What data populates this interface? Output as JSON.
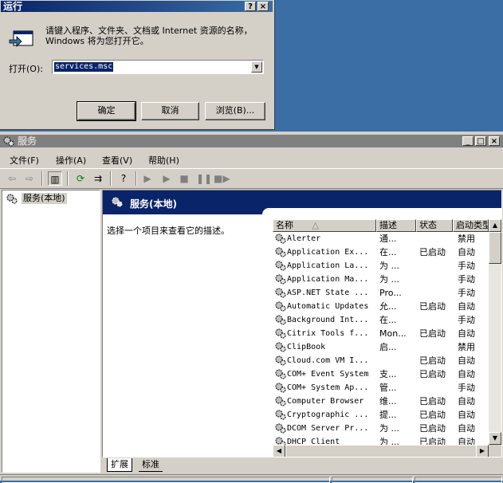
{
  "run_dialog": {
    "title": "运行",
    "help_btn": "?",
    "close_btn": "×",
    "description": "请键入程序、文件夹、文档或 Internet 资源的名称，Windows 将为您打开它。",
    "open_label": "打开(O):",
    "open_value": "services.msc",
    "buttons": {
      "ok": "确定",
      "cancel": "取消",
      "browse": "浏览(B)..."
    }
  },
  "services_window": {
    "title": "服务",
    "menus": [
      "文件(F)",
      "操作(A)",
      "查看(V)",
      "帮助(H)"
    ],
    "tree_item": "服务(本地)",
    "content_title": "服务(本地)",
    "content_desc": "选择一个项目来查看它的描述。",
    "columns": [
      "名称",
      "描述",
      "状态",
      "启动类型"
    ],
    "rows": [
      [
        "Alerter",
        "通...",
        "",
        "禁用"
      ],
      [
        "Application Ex...",
        "在...",
        "已启动",
        "自动"
      ],
      [
        "Application La...",
        "为 ...",
        "",
        "手动"
      ],
      [
        "Application Ma...",
        "为 ...",
        "",
        "手动"
      ],
      [
        "ASP.NET State ...",
        "Pro...",
        "",
        "手动"
      ],
      [
        "Automatic Updates",
        "允...",
        "已启动",
        "自动"
      ],
      [
        "Background Int...",
        "在...",
        "",
        "手动"
      ],
      [
        "Citrix Tools f...",
        "Mon...",
        "已启动",
        "自动"
      ],
      [
        "ClipBook",
        "启...",
        "",
        "禁用"
      ],
      [
        "Cloud.com VM I...",
        "",
        "已启动",
        "自动"
      ],
      [
        "COM+ Event System",
        "支...",
        "已启动",
        "自动"
      ],
      [
        "COM+ System Ap...",
        "管...",
        "",
        "手动"
      ],
      [
        "Computer Browser",
        "维...",
        "已启动",
        "自动"
      ],
      [
        "Cryptographic ...",
        "提...",
        "已启动",
        "自动"
      ],
      [
        "DCOM Server Pr...",
        "为 ...",
        "已启动",
        "自动"
      ],
      [
        "DHCP Client",
        "为 ...",
        "已启动",
        "自动"
      ]
    ],
    "tabs": [
      "扩展",
      "标准"
    ]
  }
}
